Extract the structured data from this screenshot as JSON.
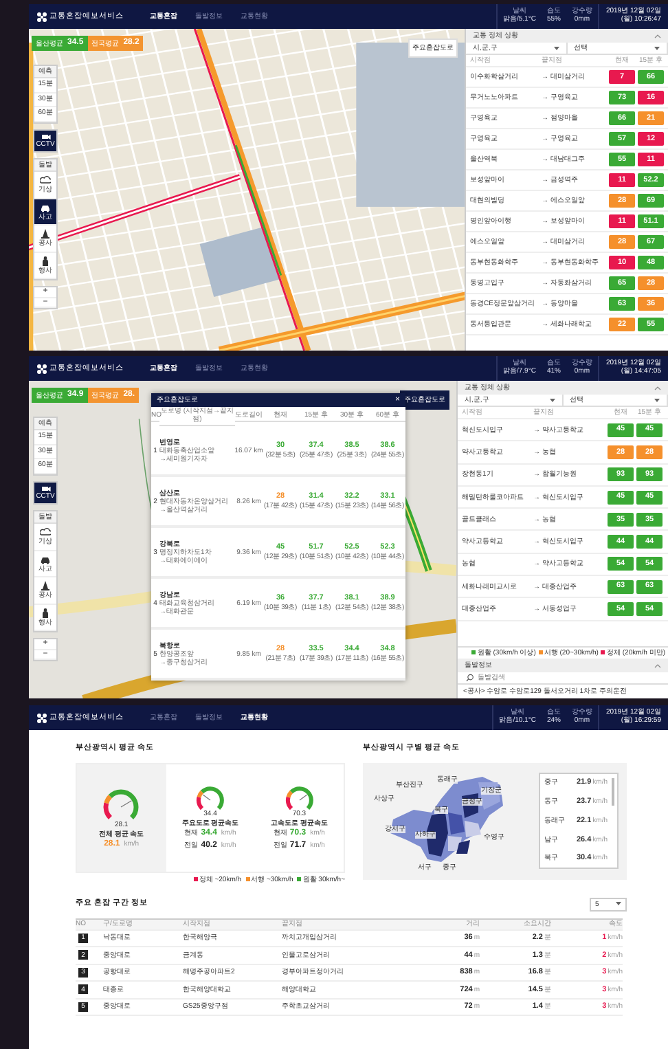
{
  "screen_1": {
    "header": {
      "logo": "교통혼잡예보서비스",
      "nav": [
        {
          "label": "교통혼잡",
          "selected": true
        },
        {
          "label": "돌발정보",
          "selected": false
        },
        {
          "label": "교통현황",
          "selected": false
        }
      ],
      "weather": [
        {
          "label": "날씨",
          "value": "맑음/5.1°C"
        },
        {
          "label": "습도",
          "value": "55%"
        },
        {
          "label": "강수량",
          "value": "0mm"
        }
      ],
      "date": "2019년 12월 02일",
      "time": "(월) 10:26:47"
    },
    "averages": [
      {
        "label": "울산평균",
        "value": "34.5",
        "color": "#3aaa35"
      },
      {
        "label": "전국평균",
        "value": "28.2",
        "color": "#f39430"
      }
    ],
    "forecast": {
      "title": "예측",
      "options": [
        "15분",
        "30분",
        "60분"
      ]
    },
    "cctv": {
      "label": "CCTV",
      "on": true
    },
    "incident_layers": {
      "title": "돌발",
      "items": [
        {
          "kind": "weather",
          "label": "기상",
          "selected": false
        },
        {
          "kind": "accident",
          "label": "사고",
          "selected": true
        },
        {
          "kind": "construction",
          "label": "공사",
          "selected": false
        },
        {
          "kind": "event",
          "label": "행사",
          "selected": false
        }
      ]
    },
    "zoom": [
      "+",
      "−"
    ],
    "congested_roads_button": {
      "label": "주요혼잡도로",
      "selected": false
    },
    "sidebar": {
      "title": "교통 정체 상황",
      "selects": [
        "시,군,구",
        "선택"
      ],
      "columns": [
        "시작점",
        "끝지점",
        "현재",
        "15분 후"
      ],
      "rows": [
        {
          "start": "이수화학삼거리",
          "end": "→ 대미삼거리",
          "now": {
            "value": "7",
            "color": "#e8194f"
          },
          "later": {
            "value": "66",
            "color": "#3aaa35"
          }
        },
        {
          "start": "무거노노아파트",
          "end": "→ 구영육교",
          "now": {
            "value": "73",
            "color": "#3aaa35"
          },
          "later": {
            "value": "16",
            "color": "#e8194f"
          }
        },
        {
          "start": "구영육교",
          "end": "→ 점양마을",
          "now": {
            "value": "66",
            "color": "#3aaa35"
          },
          "later": {
            "value": "21",
            "color": "#f5902c"
          }
        },
        {
          "start": "구영육교",
          "end": "→ 구영육교",
          "now": {
            "value": "57",
            "color": "#3aaa35"
          },
          "later": {
            "value": "12",
            "color": "#e8194f"
          }
        },
        {
          "start": "울산역북",
          "end": "→ 대남대그주",
          "now": {
            "value": "55",
            "color": "#3aaa35"
          },
          "later": {
            "value": "11",
            "color": "#e8194f"
          }
        },
        {
          "start": "보성앞마이",
          "end": "→ 금성역주",
          "now": {
            "value": "11",
            "color": "#e8194f"
          },
          "later": {
            "value": "52.2",
            "color": "#3aaa35"
          }
        },
        {
          "start": "대현의빌딩",
          "end": "→ 에스오일앞",
          "now": {
            "value": "28",
            "color": "#f5902c"
          },
          "later": {
            "value": "69",
            "color": "#3aaa35"
          }
        },
        {
          "start": "명인앞아이행",
          "end": "→ 보성앞마이",
          "now": {
            "value": "11",
            "color": "#e8194f"
          },
          "later": {
            "value": "51.1",
            "color": "#3aaa35"
          }
        },
        {
          "start": "에스오일앞",
          "end": "→ 대미삼거리",
          "now": {
            "value": "28",
            "color": "#f5902c"
          },
          "later": {
            "value": "67",
            "color": "#3aaa35"
          }
        },
        {
          "start": "동부현동화학주",
          "end": "→ 동부현동화학주",
          "now": {
            "value": "10",
            "color": "#e8194f"
          },
          "later": {
            "value": "48",
            "color": "#3aaa35"
          }
        },
        {
          "start": "동명고입구",
          "end": "→ 자동화삼거리",
          "now": {
            "value": "65",
            "color": "#3aaa35"
          },
          "later": {
            "value": "28",
            "color": "#f5902c"
          }
        },
        {
          "start": "동경CE정문앞삼거리",
          "end": "→ 동양마을",
          "now": {
            "value": "63",
            "color": "#3aaa35"
          },
          "later": {
            "value": "36",
            "color": "#f5902c"
          }
        },
        {
          "start": "동서등입관문",
          "end": "→ 세화나래학교",
          "now": {
            "value": "22",
            "color": "#f5902c"
          },
          "later": {
            "value": "55",
            "color": "#3aaa35"
          }
        }
      ]
    }
  },
  "screen_2": {
    "header": {
      "logo": "교통혼잡예보서비스",
      "nav": [
        {
          "label": "교통혼잡",
          "selected": true
        },
        {
          "label": "돌발정보",
          "selected": false
        },
        {
          "label": "교통현황",
          "selected": false
        }
      ],
      "weather": [
        {
          "label": "날씨",
          "value": "맑음/7.9°C"
        },
        {
          "label": "습도",
          "value": "41%"
        },
        {
          "label": "강수량",
          "value": "0mm"
        }
      ],
      "date": "2019년 12월 02일",
      "time": "(월) 14:47:05"
    },
    "averages": [
      {
        "label": "울산평균",
        "value": "34.9",
        "color": "#3aaa35"
      },
      {
        "label": "전국평균",
        "value": "28.",
        "color": "#f39430"
      }
    ],
    "forecast": {
      "title": "예측",
      "options": [
        "15분",
        "30분",
        "60분"
      ]
    },
    "cctv": {
      "label": "CCTV",
      "on": true
    },
    "incident_layers": {
      "title": "돌발",
      "items": [
        {
          "kind": "weather",
          "label": "기상",
          "selected": false
        },
        {
          "kind": "accident",
          "label": "사고",
          "selected": false
        },
        {
          "kind": "construction",
          "label": "공사",
          "selected": false
        },
        {
          "kind": "event",
          "label": "행사",
          "selected": false
        }
      ]
    },
    "zoom": [
      "+",
      "−"
    ],
    "congested_roads_button": {
      "label": "주요혼잡도로",
      "selected": true
    },
    "popup": {
      "title": "주요혼잡도로",
      "close": "×",
      "columns": [
        "NO",
        "도로명 (시작지점→끝지점)",
        "도로길이",
        "현재",
        "15분 후",
        "30분 후",
        "60분 후"
      ],
      "rows": [
        {
          "no": "1",
          "road": "번영로",
          "from": "태화동축산업소앞",
          "to": "→세미원기자차",
          "length": "16.07 km",
          "speeds": [
            {
              "value": "30",
              "time": "(32분 5초)",
              "color": "#3aaa35"
            },
            {
              "value": "37.4",
              "time": "(25분 47초)",
              "color": "#3aaa35"
            },
            {
              "value": "38.5",
              "time": "(25분 3초)",
              "color": "#3aaa35"
            },
            {
              "value": "38.6",
              "time": "(24분 55초)",
              "color": "#3aaa35"
            }
          ]
        },
        {
          "no": "2",
          "road": "삼산로",
          "from": "현대자동차온양삼거리",
          "to": "→울산역삼거리",
          "length": "8.26 km",
          "speeds": [
            {
              "value": "28",
              "time": "(17분 42초)",
              "color": "#f5902c"
            },
            {
              "value": "31.4",
              "time": "(15분 47초)",
              "color": "#3aaa35"
            },
            {
              "value": "32.2",
              "time": "(15분 23초)",
              "color": "#3aaa35"
            },
            {
              "value": "33.1",
              "time": "(14분 56초)",
              "color": "#3aaa35"
            }
          ]
        },
        {
          "no": "3",
          "road": "강북로",
          "from": "명정지하차도1차",
          "to": "→태화에이에이",
          "length": "9.36 km",
          "speeds": [
            {
              "value": "45",
              "time": "(12분 29초)",
              "color": "#3aaa35"
            },
            {
              "value": "51.7",
              "time": "(10분 51초)",
              "color": "#3aaa35"
            },
            {
              "value": "52.5",
              "time": "(10분 42초)",
              "color": "#3aaa35"
            },
            {
              "value": "52.3",
              "time": "(10분 44초)",
              "color": "#3aaa35"
            }
          ]
        },
        {
          "no": "4",
          "road": "강남로",
          "from": "태화교육청삼거리",
          "to": "→태화관문",
          "length": "6.19 km",
          "speeds": [
            {
              "value": "36",
              "time": "(10분 39초)",
              "color": "#3aaa35"
            },
            {
              "value": "37.7",
              "time": "(11분 1초)",
              "color": "#3aaa35"
            },
            {
              "value": "38.1",
              "time": "(12분 54초)",
              "color": "#3aaa35"
            },
            {
              "value": "38.9",
              "time": "(12분 38초)",
              "color": "#3aaa35"
            }
          ]
        },
        {
          "no": "5",
          "road": "북항로",
          "from": "한양공조앞",
          "to": "→중구청삼거리",
          "length": "9.85 km",
          "speeds": [
            {
              "value": "28",
              "time": "(21분 7초)",
              "color": "#f5902c"
            },
            {
              "value": "33.5",
              "time": "(17분 39초)",
              "color": "#3aaa35"
            },
            {
              "value": "34.4",
              "time": "(17분 11초)",
              "color": "#3aaa35"
            },
            {
              "value": "34.8",
              "time": "(16분 55초)",
              "color": "#3aaa35"
            }
          ]
        }
      ]
    },
    "sidebar": {
      "title": "교통 정체 상황",
      "selects": [
        "시,군,구",
        "선택"
      ],
      "columns": [
        "시작점",
        "끝지점",
        "현재",
        "15분 후"
      ],
      "rows": [
        {
          "start": "혁신도시입구",
          "end": "→ 약사고등학교",
          "now": {
            "value": "45",
            "color": "#3aaa35"
          },
          "later": {
            "value": "45",
            "color": "#3aaa35"
          }
        },
        {
          "start": "약사고등학교",
          "end": "→ 농협",
          "now": {
            "value": "28",
            "color": "#f5902c"
          },
          "later": {
            "value": "28",
            "color": "#f5902c"
          }
        },
        {
          "start": "장현동1기",
          "end": "→ 함월기능원",
          "now": {
            "value": "93",
            "color": "#3aaa35"
          },
          "later": {
            "value": "93",
            "color": "#3aaa35"
          }
        },
        {
          "start": "해밀턴하룰코아파트",
          "end": "→ 혁신도시입구",
          "now": {
            "value": "45",
            "color": "#3aaa35"
          },
          "later": {
            "value": "45",
            "color": "#3aaa35"
          }
        },
        {
          "start": "골드클래스",
          "end": "→ 농협",
          "now": {
            "value": "35",
            "color": "#3aaa35"
          },
          "later": {
            "value": "35",
            "color": "#3aaa35"
          }
        },
        {
          "start": "약사고등학교",
          "end": "→ 혁신도시입구",
          "now": {
            "value": "44",
            "color": "#3aaa35"
          },
          "later": {
            "value": "44",
            "color": "#3aaa35"
          }
        },
        {
          "start": "농협",
          "end": "→ 약사고등학교",
          "now": {
            "value": "54",
            "color": "#3aaa35"
          },
          "later": {
            "value": "54",
            "color": "#3aaa35"
          }
        },
        {
          "start": "세화나래미교시로",
          "end": "→ 대종산업주",
          "now": {
            "value": "63",
            "color": "#3aaa35"
          },
          "later": {
            "value": "63",
            "color": "#3aaa35"
          }
        },
        {
          "start": "대종산업주",
          "end": "→ 서동성업구",
          "now": {
            "value": "54",
            "color": "#3aaa35"
          },
          "later": {
            "value": "54",
            "color": "#3aaa35"
          }
        }
      ]
    },
    "legend": [
      {
        "color": "#3aaa35",
        "label": "원활 (30km/h 이상)"
      },
      {
        "color": "#f5902c",
        "label": "서행 (20~30km/h)"
      },
      {
        "color": "#e8194f",
        "label": "정체 (20km/h 미만)"
      }
    ],
    "incidents": {
      "title": "돌발정보",
      "placeholder": "돌발검색",
      "items": [
        "<공사> 수암로 수암로129 돌서오거리 1차로 주의운전"
      ]
    }
  },
  "screen_3": {
    "header": {
      "logo": "교통혼잡예보서비스",
      "nav": [
        {
          "label": "교통혼잡",
          "selected": false
        },
        {
          "label": "돌발정보",
          "selected": false
        },
        {
          "label": "교통현황",
          "selected": true
        }
      ],
      "weather": [
        {
          "label": "날씨",
          "value": "맑음/10.1°C"
        },
        {
          "label": "습도",
          "value": "24%"
        },
        {
          "label": "강수량",
          "value": "0mm"
        }
      ],
      "date": "2019년 12월 02일",
      "time": "(월) 16:29:59"
    },
    "city_speed": {
      "title": "부산광역시 평균 속도",
      "gauges": [
        {
          "kind": "total",
          "gauge_value": "28.1",
          "level": 0.72,
          "title": "전체 평균 속도",
          "value": "28.1",
          "unit": "km/h",
          "color": "#f5902c"
        },
        {
          "kind": "split",
          "gauge_value": "34.4",
          "level": 0.3,
          "title": "주요도로 평균속도",
          "lines": [
            {
              "label": "현재",
              "value": "34.4",
              "unit": "km/h",
              "color": "#3aaa35"
            },
            {
              "label": "전일",
              "value": "40.2",
              "unit": "km/h",
              "color": "#222222"
            }
          ]
        },
        {
          "kind": "split",
          "gauge_value": "70.3",
          "level": 0.7,
          "title": "고속도로 평균속도",
          "lines": [
            {
              "label": "현재",
              "value": "70.3",
              "unit": "km/h",
              "color": "#3aaa35"
            },
            {
              "label": "전일",
              "value": "71.7",
              "unit": "km/h",
              "color": "#222222"
            }
          ]
        }
      ],
      "legend": [
        {
          "color": "#e8194f",
          "label": "정체 ~20km/h"
        },
        {
          "color": "#f5902c",
          "label": "서행 ~30km/h"
        },
        {
          "color": "#3aaa35",
          "label": "원활 30km/h~"
        }
      ]
    },
    "district_speed": {
      "title": "부산광역시 구별 평균 속도",
      "map_labels": [
        "기장군",
        "동래구",
        "부산진구",
        "사상구",
        "북구",
        "금정구",
        "강서구",
        "수영구",
        "사하구",
        "서구",
        "중구"
      ],
      "list": [
        {
          "district": "중구",
          "value": "21.9",
          "unit": "km/h"
        },
        {
          "district": "동구",
          "value": "23.7",
          "unit": "km/h"
        },
        {
          "district": "동래구",
          "value": "22.1",
          "unit": "km/h"
        },
        {
          "district": "남구",
          "value": "26.4",
          "unit": "km/h"
        },
        {
          "district": "북구",
          "value": "30.4",
          "unit": "km/h"
        }
      ]
    },
    "sections": {
      "title": "주요 혼잡 구간 정보",
      "select": "5",
      "columns": [
        "NO",
        "구/도로명",
        "시작지점",
        "끝지점",
        "거리",
        "소요시간",
        "속도"
      ],
      "rows": [
        {
          "no": "1",
          "road": "낙동대로",
          "from": "한국해양극",
          "to": "까치고개입삼거리",
          "distance": "36",
          "distance_unit": "m",
          "duration": "2.2",
          "duration_unit": "분",
          "speed": "1",
          "speed_unit": "km/h"
        },
        {
          "no": "2",
          "road": "중앙대로",
          "from": "금계동",
          "to": "인물고로삼거리",
          "distance": "44",
          "distance_unit": "m",
          "duration": "1.3",
          "duration_unit": "분",
          "speed": "2",
          "speed_unit": "km/h"
        },
        {
          "no": "3",
          "road": "공항대로",
          "from": "해명주공아파트2",
          "to": "경부아파트정아거리",
          "distance": "838",
          "distance_unit": "m",
          "duration": "16.8",
          "duration_unit": "분",
          "speed": "3",
          "speed_unit": "km/h"
        },
        {
          "no": "4",
          "road": "태종로",
          "from": "한국해양대학교",
          "to": "해양대학교",
          "distance": "724",
          "distance_unit": "m",
          "duration": "14.5",
          "duration_unit": "분",
          "speed": "3",
          "speed_unit": "km/h"
        },
        {
          "no": "5",
          "road": "중앙대로",
          "from": "GS25중앙구점",
          "to": "주학초교삼거리",
          "distance": "72",
          "distance_unit": "m",
          "duration": "1.4",
          "duration_unit": "분",
          "speed": "3",
          "speed_unit": "km/h"
        }
      ]
    }
  }
}
